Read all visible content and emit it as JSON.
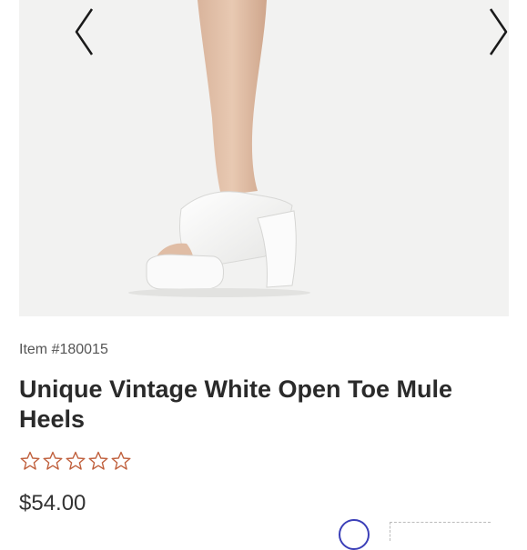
{
  "gallery": {
    "image_alt": "White open toe platform mule heel worn on foot",
    "prev_icon": "chevron-left-icon",
    "next_icon": "chevron-right-icon"
  },
  "product": {
    "item_number": "Item #180015",
    "title": "Unique Vintage White Open Toe Mule Heels",
    "rating": {
      "filled": 0,
      "max": 5,
      "star_color": "#c0603d"
    },
    "price": "$54.00"
  },
  "colors": {
    "accent_blue": "#3b3fb8",
    "star_outline": "#c0603d"
  }
}
